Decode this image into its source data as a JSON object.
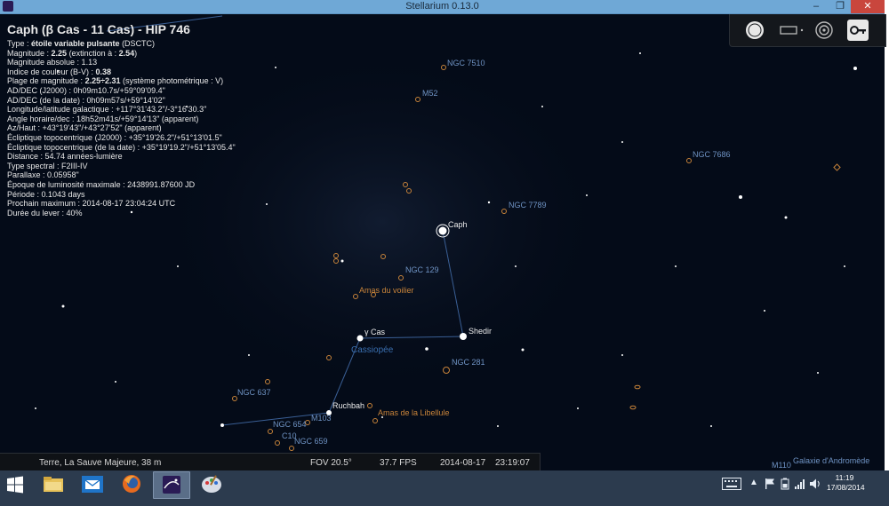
{
  "window": {
    "title": "Stellarium 0.13.0",
    "buttons": {
      "minimize": "–",
      "restore": "❐",
      "close": "✕"
    }
  },
  "object_info": {
    "title": "Caph (β Cas - 11 Cas) - HIP 746",
    "type_label": "Type : ",
    "type_value": "étoile variable pulsante",
    "type_suffix": " (DSCTC)",
    "magnitude_label": "Magnitude : ",
    "magnitude_value": "2.25",
    "magnitude_mid": " (extinction à : ",
    "magnitude_ext": "2.54",
    "magnitude_end": ")",
    "abs_magnitude": "Magnitude absolue : 1.13",
    "color_index_label": "Indice de couleur (B-V) : ",
    "color_index_value": "0.38",
    "mag_range_label": "Plage de magnitude : ",
    "mag_range_value": "2.25÷2.31",
    "mag_range_suffix": " (système photométrique : V)",
    "radec_j2000": "AD/DEC (J2000) : 0h09m10.7s/+59°09'09.4\"",
    "radec_date": "AD/DEC (de la date) : 0h09m57s/+59°14'02\"",
    "galactic": "Longitude/latitude galactique : +117°31'43.2\"/-3°16'30.3\"",
    "hour_angle": "Angle horaire/dec : 18h52m41s/+59°14'13\" (apparent)",
    "az_alt": "Az/Haut : +43°19'43\"/+43°27'52\" (apparent)",
    "ecl_j2000": "Écliptique topocentrique (J2000) : +35°19'26.2\"/+51°13'01.5\"",
    "ecl_date": "Écliptique topocentrique (de la date) : +35°19'19.2\"/+51°13'05.4\"",
    "distance": "Distance : 54.74 années-lumière",
    "spectral": "Type spectral : F2III-IV",
    "parallax": "Parallaxe : 0.05958\"",
    "epoch": "Époque de luminosité maximale : 2438991.87600 JD",
    "period": "Période : 0.1043 days",
    "next_max": "Prochain maximum : 2014-08-17 23:04:24 UTC",
    "rise_duration": "Durée du lever : 40%"
  },
  "sky_labels": {
    "ngc7510": "NGC 7510",
    "m52": "M52",
    "ngc7686": "NGC 7686",
    "ngc7789": "NGC 7789",
    "caph": "Caph",
    "ngc129": "NGC 129",
    "amas_voilier": "Amas du voilier",
    "gamma_cas": "γ Cas",
    "cassiopee": "Cassiopée",
    "shedir": "Shedir",
    "ngc281": "NGC 281",
    "ngc637": "NGC 637",
    "ruchbah": "Ruchbah",
    "m103": "M103",
    "amas_libellule": "Amas de la Libellule",
    "ngc654": "NGC 654",
    "c10": "C10",
    "ngc659": "NGC 659",
    "m110": "M110",
    "andromeda": "Galaxie d'Andromède"
  },
  "view_toolbar": {
    "icons": [
      "full-circle-icon",
      "rectangle-dot-icon",
      "target-rings-icon",
      "key-icon"
    ]
  },
  "status_bar": {
    "location": "Terre, La Sauve Majeure, 38 m",
    "fov": "FOV 20.5°",
    "fps": "37.7 FPS",
    "date": "2014-08-17",
    "time": "23:19:07"
  },
  "taskbar": {
    "apps": [
      "windows-start-icon",
      "file-explorer-icon",
      "mail-icon",
      "firefox-icon",
      "stellarium-icon",
      "paint-icon"
    ],
    "clock_time": "11:19",
    "clock_date": "17/08/2014"
  },
  "colors": {
    "sky": "#040b18",
    "nebula_orange": "#c9843a",
    "label_blue": "#6f93c4",
    "constellation_line": "#3a5f95"
  }
}
